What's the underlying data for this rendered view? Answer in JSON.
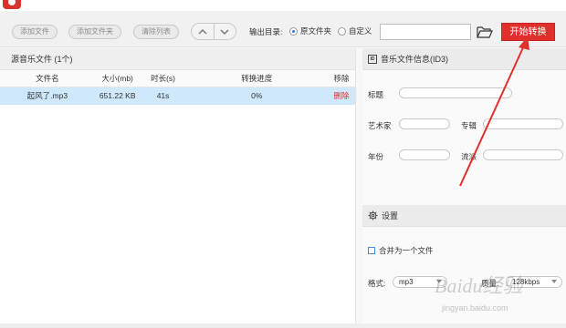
{
  "window": {
    "title": ""
  },
  "toolbar": {
    "add_file": "添加文件",
    "add_folder": "添加文件夹",
    "clear_list": "清除列表",
    "output_dir_label": "输出目录:",
    "radio_original": "原文件夹",
    "radio_custom": "自定义",
    "output_path": "",
    "start_label": "开始转换"
  },
  "file_list": {
    "header": "源音乐文件 (1个)",
    "columns": [
      "文件名",
      "大小(mb)",
      "时长(s)",
      "转换进度",
      "移除"
    ],
    "rows": [
      {
        "name": "起风了.mp3",
        "size": "651.22 KB",
        "duration": "41s",
        "progress": "0%",
        "remove": "删除"
      }
    ]
  },
  "id3": {
    "header": "音乐文件信息(ID3)",
    "title_label": "标题",
    "artist_label": "艺术家",
    "album_label": "专辑",
    "year_label": "年份",
    "genre_label": "流派",
    "title": "",
    "artist": "",
    "album": "",
    "year": "",
    "genre": ""
  },
  "settings": {
    "header": "设置",
    "merge_label": "合并为一个文件",
    "format_label": "格式:",
    "format_value": "mp3",
    "quality_label": "质量:",
    "quality_value": "128kbps"
  },
  "watermark": {
    "brand": "Baidu经验",
    "url": "jingyan.baidu.com"
  },
  "colors": {
    "accent": "#e0302b",
    "selected_row": "#cfe8fb"
  }
}
